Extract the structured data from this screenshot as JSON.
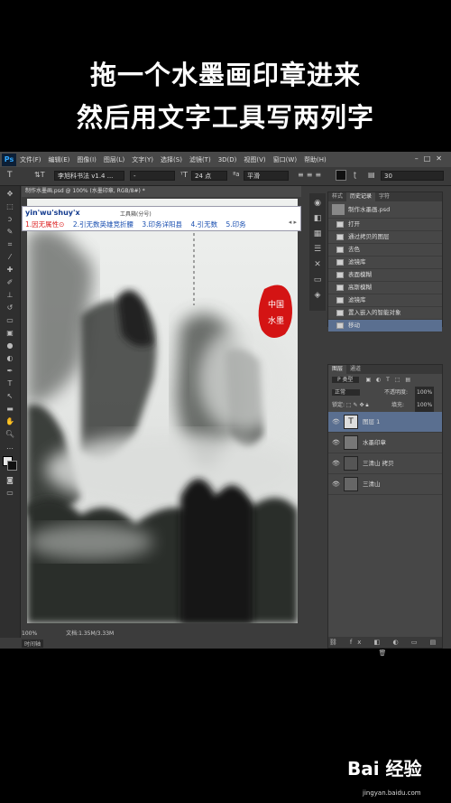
{
  "captions": [
    "拖一个水墨画印章进来",
    "然后用文字工具写两列字"
  ],
  "menu": [
    "文件(F)",
    "编辑(E)",
    "图像(I)",
    "图层(L)",
    "文字(Y)",
    "选择(S)",
    "滤镜(T)",
    "3D(D)",
    "视图(V)",
    "窗口(W)",
    "帮助(H)"
  ],
  "app_logo": "Ps",
  "options": {
    "font": "李旭科书法 v1.4 ...",
    "style": "-",
    "size": "24 点",
    "aa": "平滑",
    "anchor": "30"
  },
  "document_tab": "制作水墨画.psd @ 100% (水墨印章, RGB/8#) *",
  "ime": {
    "pinyin": "yin'wu'shuy'x",
    "hint": "工具箱(分号)",
    "candidates": [
      "1.因无属性⊙",
      "2.引无数英雄竞折腰",
      "3.印务详阳县",
      "4.引无数",
      "5.印务"
    ],
    "nav": "◂ ▸"
  },
  "status": {
    "zoom": "100%",
    "doc": "文档:1.35M/3.33M"
  },
  "seal_text": "中国水墨",
  "history": {
    "tabs": [
      "样式",
      "历史记录",
      "字符"
    ],
    "document": "制作水墨画.psd",
    "items": [
      "打开",
      "通过拷贝的图层",
      "去色",
      "滤镜库",
      "表面模糊",
      "高斯模糊",
      "滤镜库",
      "置入嵌入的智能对象",
      "移动"
    ]
  },
  "layers": {
    "tabs": [
      "图层",
      "通道"
    ],
    "kind": "P 类型",
    "blend": "正常",
    "opacity_label": "不透明度:",
    "opacity": "100%",
    "fill_label": "填充:",
    "fill": "100%",
    "items": [
      {
        "name": "图层 1",
        "type": "T"
      },
      {
        "name": "水墨印章",
        "type": ""
      },
      {
        "name": "三清山 拷贝",
        "type": ""
      },
      {
        "name": "三清山",
        "type": ""
      }
    ]
  },
  "bottom_tab": "时间轴",
  "watermark": "Bai 经验",
  "watermark_url": "jingyan.baidu.com"
}
